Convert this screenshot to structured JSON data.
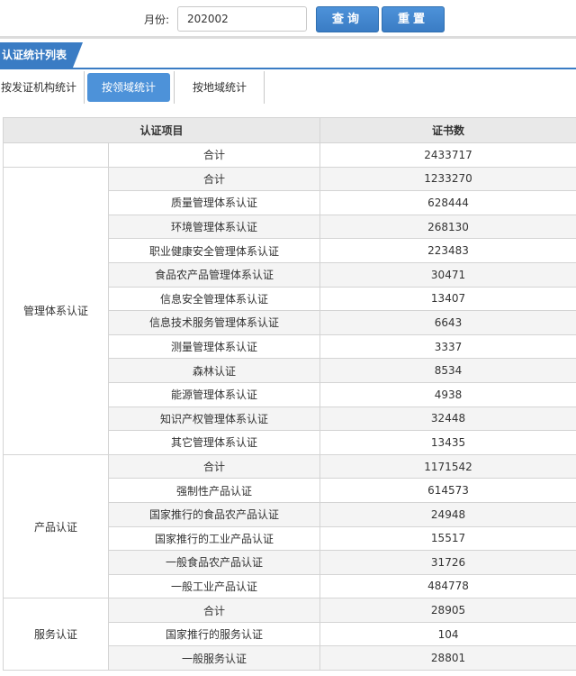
{
  "search": {
    "month_label": "月份:",
    "month_value": "202002",
    "query_label": "查询",
    "reset_label": "重置"
  },
  "section": {
    "title": "认证统计列表"
  },
  "tabs": [
    {
      "label": "按发证机构统计",
      "active": false
    },
    {
      "label": "按领域统计",
      "active": true
    },
    {
      "label": "按地域统计",
      "active": false
    }
  ],
  "table": {
    "headers": [
      "认证项目",
      "证书数"
    ],
    "grand_total": {
      "label": "合计",
      "value": "2433717"
    },
    "groups": [
      {
        "name": "管理体系认证",
        "rows": [
          {
            "label": "合计",
            "value": "1233270"
          },
          {
            "label": "质量管理体系认证",
            "value": "628444"
          },
          {
            "label": "环境管理体系认证",
            "value": "268130"
          },
          {
            "label": "职业健康安全管理体系认证",
            "value": "223483"
          },
          {
            "label": "食品农产品管理体系认证",
            "value": "30471"
          },
          {
            "label": "信息安全管理体系认证",
            "value": "13407"
          },
          {
            "label": "信息技术服务管理体系认证",
            "value": "6643"
          },
          {
            "label": "测量管理体系认证",
            "value": "3337"
          },
          {
            "label": "森林认证",
            "value": "8534"
          },
          {
            "label": "能源管理体系认证",
            "value": "4938"
          },
          {
            "label": "知识产权管理体系认证",
            "value": "32448"
          },
          {
            "label": "其它管理体系认证",
            "value": "13435"
          }
        ]
      },
      {
        "name": "产品认证",
        "rows": [
          {
            "label": "合计",
            "value": "1171542"
          },
          {
            "label": "强制性产品认证",
            "value": "614573"
          },
          {
            "label": "国家推行的食品农产品认证",
            "value": "24948"
          },
          {
            "label": "国家推行的工业产品认证",
            "value": "15517"
          },
          {
            "label": "一般食品农产品认证",
            "value": "31726"
          },
          {
            "label": "一般工业产品认证",
            "value": "484778"
          }
        ]
      },
      {
        "name": "服务认证",
        "rows": [
          {
            "label": "合计",
            "value": "28905"
          },
          {
            "label": "国家推行的服务认证",
            "value": "104"
          },
          {
            "label": "一般服务认证",
            "value": "28801"
          }
        ]
      }
    ]
  }
}
